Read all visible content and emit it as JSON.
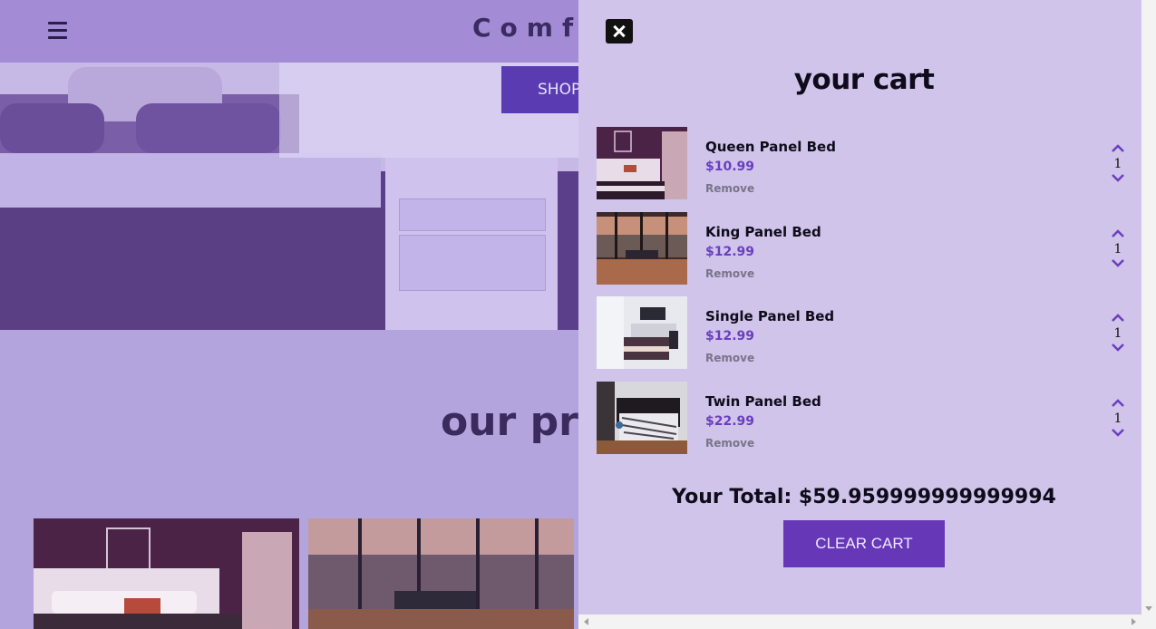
{
  "navbar": {
    "logo": "Comfy"
  },
  "hero": {
    "button_label": "SHOP"
  },
  "products_section": {
    "title": "our pro"
  },
  "cart": {
    "title": "your cart",
    "items": [
      {
        "name": "Queen Panel Bed",
        "price": "$10.99",
        "remove_label": "Remove",
        "quantity": "1"
      },
      {
        "name": "King Panel Bed",
        "price": "$12.99",
        "remove_label": "Remove",
        "quantity": "1"
      },
      {
        "name": "Single Panel Bed",
        "price": "$12.99",
        "remove_label": "Remove",
        "quantity": "1"
      },
      {
        "name": "Twin Panel Bed",
        "price": "$22.99",
        "remove_label": "Remove",
        "quantity": "1"
      }
    ],
    "total": "Your Total: $59.959999999999994",
    "clear_label": "CLEAR CART"
  },
  "colors": {
    "accent": "#6638b8",
    "price": "#6a3fbf",
    "cart_bg": "#d0c4ea",
    "navbar_bg": "#a38bd5"
  },
  "icons": {
    "menu": "hamburger-icon",
    "close": "close-icon",
    "up": "chevron-up-icon",
    "down": "chevron-down-icon"
  }
}
